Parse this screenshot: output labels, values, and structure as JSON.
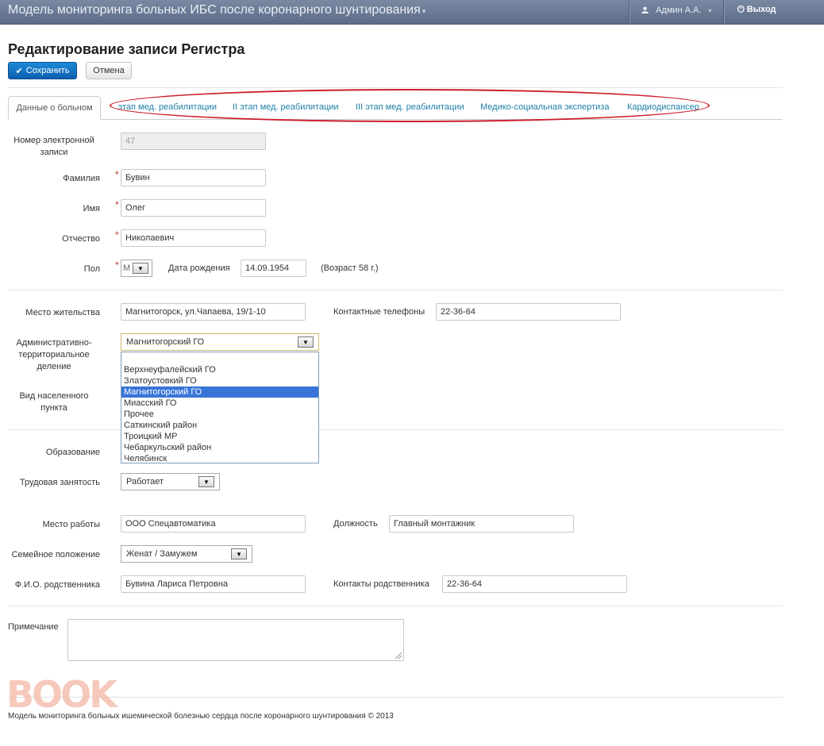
{
  "navbar": {
    "title": "Модель мониторинга больных ИБС после коронарного шунтирования",
    "user": "Админ А.А.",
    "logout": "Выход"
  },
  "page": {
    "title": "Редактирование записи Регистра",
    "save_label": "Сохранить",
    "cancel_label": "Отмена"
  },
  "tabs": [
    {
      "label": "Данные о больном",
      "active": true
    },
    {
      "label": "I этап мед. реабилитации"
    },
    {
      "label": "II этап мед. реабилитации"
    },
    {
      "label": "III этап мед. реабилитации"
    },
    {
      "label": "Медико-социальная экспертиза"
    },
    {
      "label": "Кардиодиспансер"
    }
  ],
  "form": {
    "record_number": {
      "label": "Номер электронной записи",
      "value": "47"
    },
    "last_name": {
      "label": "Фамилия",
      "value": "Бувин"
    },
    "first_name": {
      "label": "Имя",
      "value": "Олег"
    },
    "patronymic": {
      "label": "Отчество",
      "value": "Николаевич"
    },
    "sex": {
      "label": "Пол",
      "value": "М"
    },
    "birth_date": {
      "label": "Дата рождения",
      "value": "14.09.1954"
    },
    "age_note": "(Возраст 58 г.)",
    "residence": {
      "label": "Место жительства",
      "value": "Магнитогорск, ул.Чапаева, 19/1-10"
    },
    "phones": {
      "label": "Контактные телефоны",
      "value": "22-36-64"
    },
    "admin_division": {
      "label": "Административно-территориальное деление",
      "value": "Магнитогорский ГО",
      "options": [
        "",
        "Верхнеуфалейский ГО",
        "Златоустовкий ГО",
        "Магнитогорский ГО",
        "Миасский ГО",
        "Прочее",
        "Саткинский район",
        "Троицкий МР",
        "Чебаркульский район",
        "Челябинск"
      ],
      "selected_index": 3
    },
    "settlement_type": {
      "label": "Вид населенного пункта"
    },
    "education": {
      "label": "Образование"
    },
    "employment": {
      "label": "Трудовая занятость",
      "value": "Работает"
    },
    "workplace": {
      "label": "Место работы",
      "value": "ООО Спецавтоматика"
    },
    "position": {
      "label": "Должность",
      "value": "Главный монтажник"
    },
    "marital": {
      "label": "Семейное положение",
      "value": "Женат / Замужем"
    },
    "relative_name": {
      "label": "Ф.И.О. родственника",
      "value": "Бувина Лариса Петровна"
    },
    "relative_contacts": {
      "label": "Контакты родственника",
      "value": "22-36-64"
    },
    "note": {
      "label": "Примечание",
      "value": ""
    }
  },
  "footer": "Модель мониторинга больных ишемической болезнью сердца после коронарного шунтирования © 2013",
  "watermark": "BOOK"
}
